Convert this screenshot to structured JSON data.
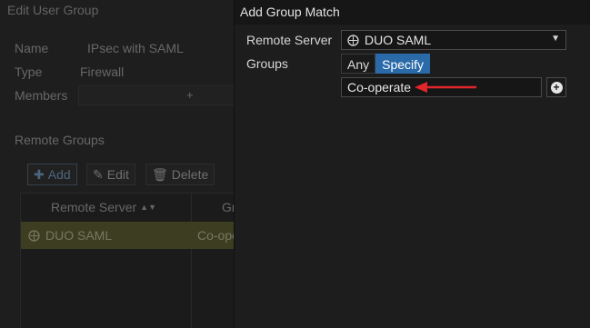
{
  "background": {
    "header_title": "Edit User Group",
    "fields": [
      {
        "label": "Name",
        "value": "IPsec with SAML"
      },
      {
        "label": "Type",
        "value": "Firewall"
      },
      {
        "label": "Members",
        "value": "+"
      }
    ],
    "remote_groups_title": "Remote Groups",
    "toolbar": {
      "add": "Add",
      "edit": "Edit",
      "delete": "Delete"
    },
    "table": {
      "col_remote_server": "Remote Server",
      "col_groups_partial": "Gr",
      "row": {
        "server": "DUO SAML",
        "group_partial": "Co-ope"
      }
    }
  },
  "panel": {
    "title": "Add Group Match",
    "remote_server_label": "Remote Server",
    "remote_server_value": "DUO SAML",
    "groups_label": "Groups",
    "groups_toggle": {
      "any": "Any",
      "specify": "Specify",
      "selected": "Specify"
    },
    "group_value": "Co-operate",
    "annotation_color": "#e0262a"
  },
  "colors": {
    "accent": "#2a6aa8",
    "selected_row": "#55552e"
  }
}
